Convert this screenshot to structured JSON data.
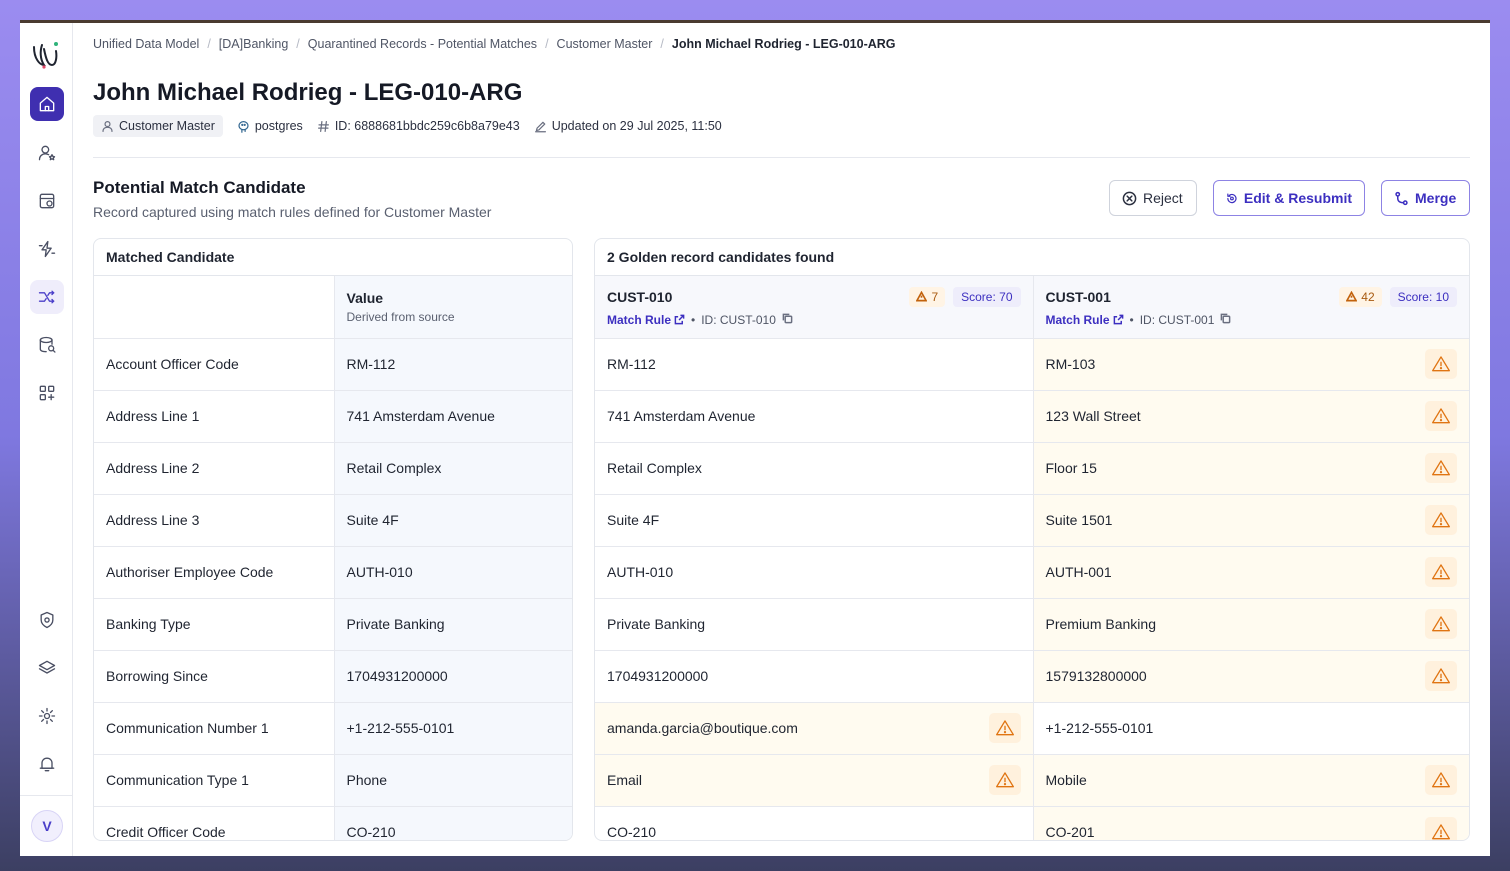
{
  "breadcrumbs": [
    "Unified Data Model",
    "[DA]Banking",
    "Quarantined Records - Potential Matches",
    "Customer Master",
    "John Michael Rodrieg - LEG-010-ARG"
  ],
  "page": {
    "title": "John Michael Rodrieg - LEG-010-ARG",
    "entity_chip": "Customer Master",
    "source": "postgres",
    "id_text": "ID: 6888681bbdc259c6b8a79e43",
    "updated_text": "Updated on 29 Jul 2025, 11:50"
  },
  "section": {
    "title": "Potential Match Candidate",
    "subtitle": "Record captured using match rules defined for Customer Master"
  },
  "actions": {
    "reject": "Reject",
    "edit_resubmit": "Edit & Resubmit",
    "merge": "Merge"
  },
  "left_panel": {
    "title": "Matched Candidate",
    "value_header": "Value",
    "value_sub": "Derived from source"
  },
  "right_panel": {
    "title": "2 Golden record candidates found",
    "candidates": [
      {
        "name": "CUST-010",
        "warnings": "7",
        "score": "Score: 70",
        "match_rule": "Match Rule",
        "id": "ID: CUST-010"
      },
      {
        "name": "CUST-001",
        "warnings": "42",
        "score": "Score: 10",
        "match_rule": "Match Rule",
        "id": "ID: CUST-001"
      }
    ]
  },
  "rows": [
    {
      "field": "Account Officer Code",
      "value": "RM-112",
      "c1": "RM-112",
      "c1_mismatch": false,
      "c2": "RM-103",
      "c2_mismatch": true
    },
    {
      "field": "Address Line 1",
      "value": "741 Amsterdam Avenue",
      "c1": "741 Amsterdam Avenue",
      "c1_mismatch": false,
      "c2": "123 Wall Street",
      "c2_mismatch": true
    },
    {
      "field": "Address Line 2",
      "value": "Retail Complex",
      "c1": "Retail Complex",
      "c1_mismatch": false,
      "c2": "Floor 15",
      "c2_mismatch": true
    },
    {
      "field": "Address Line 3",
      "value": "Suite 4F",
      "c1": "Suite 4F",
      "c1_mismatch": false,
      "c2": "Suite 1501",
      "c2_mismatch": true
    },
    {
      "field": "Authoriser Employee Code",
      "value": "AUTH-010",
      "c1": "AUTH-010",
      "c1_mismatch": false,
      "c2": "AUTH-001",
      "c2_mismatch": true
    },
    {
      "field": "Banking Type",
      "value": "Private Banking",
      "c1": "Private Banking",
      "c1_mismatch": false,
      "c2": "Premium Banking",
      "c2_mismatch": true
    },
    {
      "field": "Borrowing Since",
      "value": "1704931200000",
      "c1": "1704931200000",
      "c1_mismatch": false,
      "c2": "1579132800000",
      "c2_mismatch": true
    },
    {
      "field": "Communication Number 1",
      "value": "+1-212-555-0101",
      "c1": "amanda.garcia@boutique.com",
      "c1_mismatch": true,
      "c2": "+1-212-555-0101",
      "c2_mismatch": false
    },
    {
      "field": "Communication Type 1",
      "value": "Phone",
      "c1": "Email",
      "c1_mismatch": true,
      "c2": "Mobile",
      "c2_mismatch": true
    },
    {
      "field": "Credit Officer Code",
      "value": "CO-210",
      "c1": "CO-210",
      "c1_mismatch": false,
      "c2": "CO-201",
      "c2_mismatch": true
    }
  ],
  "user": {
    "avatar_initial": "V"
  },
  "colors": {
    "accent": "#3f2fb0",
    "warning": "#e07412",
    "mismatch_bg": "#fffbf0"
  }
}
